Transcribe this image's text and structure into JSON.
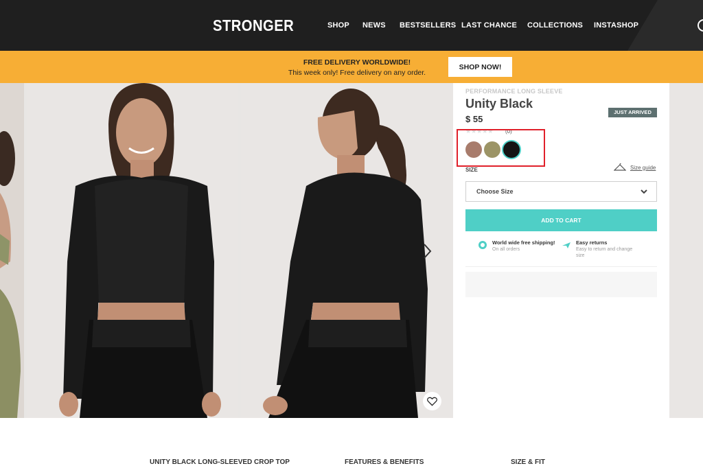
{
  "header": {
    "logo": "STRONGER",
    "nav": [
      "SHOP",
      "NEWS",
      "BESTSELLERS",
      "LAST CHANCE",
      "COLLECTIONS",
      "INSTASHOP"
    ]
  },
  "promo": {
    "title": "FREE DELIVERY WORLDWIDE!",
    "subtitle": "This week only! Free delivery on any order.",
    "button": "SHOP NOW!"
  },
  "product": {
    "category": "PERFORMANCE LONG SLEEVE",
    "name": "Unity Black",
    "price": "$ 55",
    "badge": "JUST ARRIVED",
    "stars": "★★★★★",
    "rating_count": "(0)",
    "rating": 0,
    "swatches": [
      {
        "name": "swatch-mauve",
        "color": "#a87c6c"
      },
      {
        "name": "swatch-olive",
        "color": "#9c9466"
      },
      {
        "name": "swatch-black",
        "color": "#151515",
        "selected": true
      }
    ],
    "size_label": "SIZE",
    "size_guide": "Size guide",
    "size_select": "Choose Size",
    "add_to_cart": "ADD TO CART",
    "perks": [
      {
        "title": "World wide free shipping!",
        "subtitle": "On all orders",
        "icon": "globe-icon"
      },
      {
        "title": "Easy returns",
        "subtitle": "Easy to return and change size",
        "icon": "plane-icon"
      }
    ]
  },
  "tabs": [
    "UNITY BLACK LONG-SLEEVED CROP TOP",
    "FEATURES & BENEFITS",
    "SIZE & FIT"
  ],
  "colors": {
    "header_bg": "#1f1f1f",
    "promo_bg": "#f7ae35",
    "accent": "#4fcfc6",
    "badge_bg": "#5d7070",
    "highlight": "#e0202a"
  }
}
